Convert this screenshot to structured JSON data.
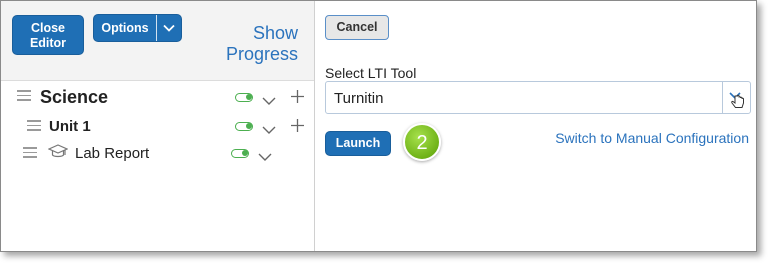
{
  "left": {
    "close_editor_line1": "Close",
    "close_editor_line2": "Editor",
    "options_label": "Options",
    "show_progress_line1": "Show",
    "show_progress_line2": "Progress",
    "tree": [
      {
        "title": "Science"
      },
      {
        "title": "Unit 1"
      },
      {
        "title": "Lab Report"
      }
    ]
  },
  "right": {
    "cancel_label": "Cancel",
    "select_label": "Select LTI Tool",
    "select_value": "Turnitin",
    "launch_label": "Launch",
    "step_number": "2",
    "manual_link": "Switch to Manual Configuration"
  },
  "colors": {
    "primary_blue": "#1f6fb5",
    "link_blue": "#2b73bd",
    "toggle_green": "#4caf50",
    "badge_green": "#6fb218"
  },
  "icons": [
    "drag-handle-icon",
    "toggle-icon",
    "chevron-down-icon",
    "plus-icon",
    "graduation-cap-icon",
    "hand-cursor-icon"
  ]
}
